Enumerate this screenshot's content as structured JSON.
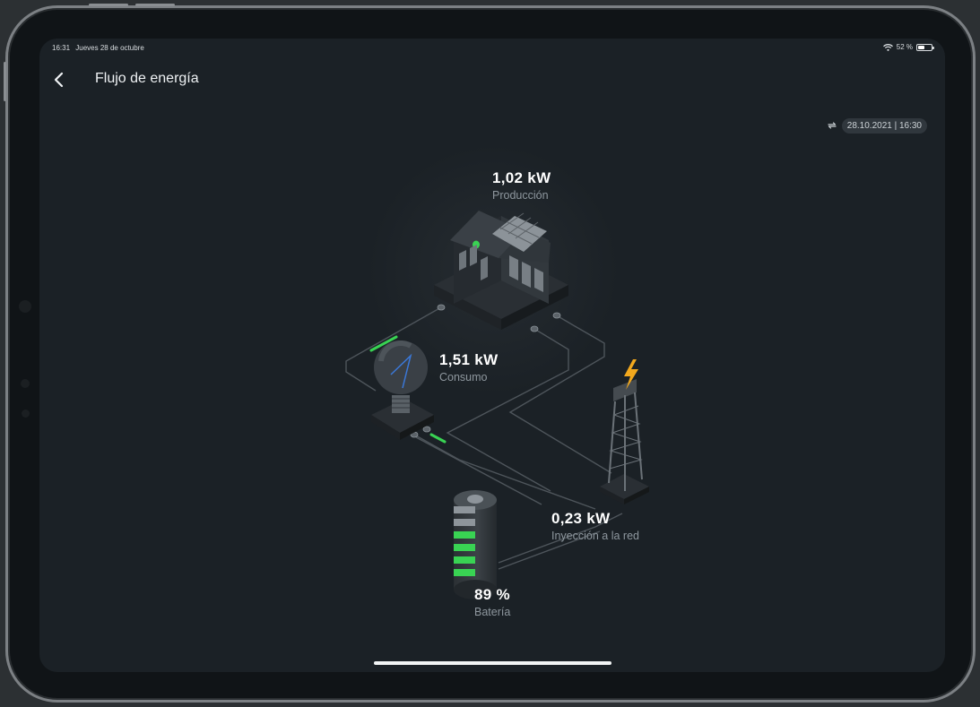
{
  "status_bar": {
    "time": "16:31",
    "date": "Jueves 28 de octubre",
    "battery_text": "52 %",
    "battery_level": 0.52,
    "wifi_icon": "wifi-icon"
  },
  "nav": {
    "back_icon": "chevron-left-icon",
    "title": "Flujo de energía"
  },
  "timestamp": {
    "icon": "refresh-icon",
    "text": "28.10.2021 | 16:30"
  },
  "flow": {
    "production": {
      "value": "1,02 kW",
      "label": "Producción"
    },
    "consumption": {
      "value": "1,51 kW",
      "label": "Consumo"
    },
    "grid": {
      "value": "0,23 kW",
      "label": "Inyección a la red"
    },
    "battery": {
      "value": "89 %",
      "label": "Batería",
      "level": 0.89
    }
  },
  "colors": {
    "accent_green": "#39d353",
    "bolt_yellow": "#f2a81d",
    "background": "#1b2126"
  }
}
